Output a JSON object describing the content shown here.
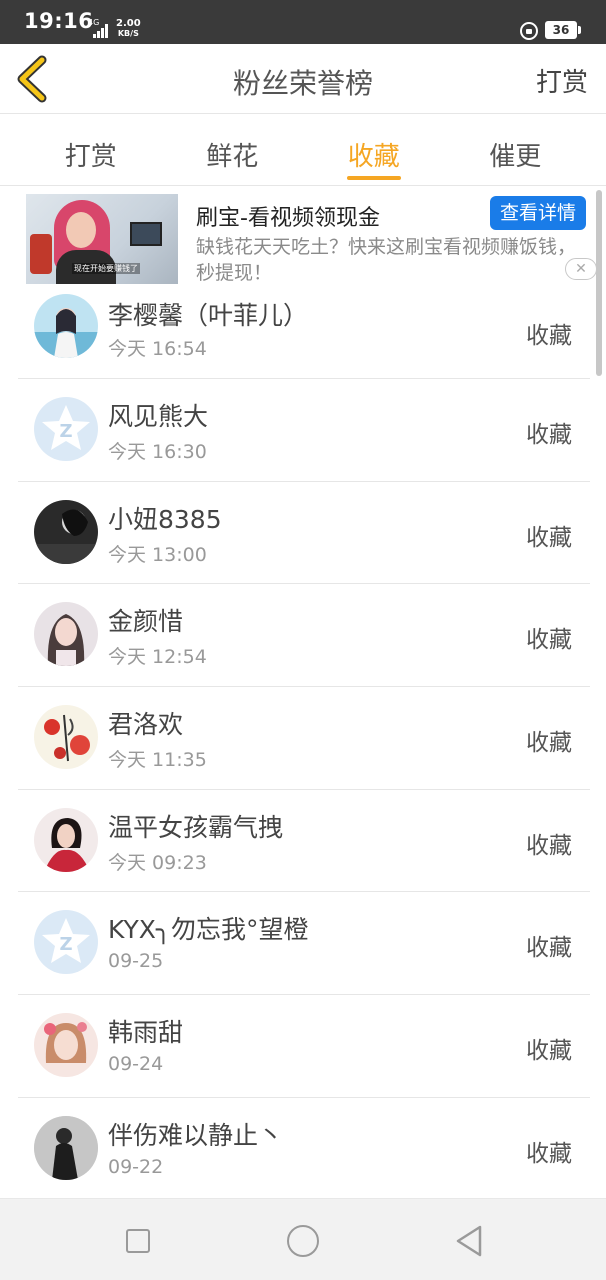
{
  "status_bar": {
    "time": "19:16",
    "network": "4G",
    "speed_value": "2.00",
    "speed_unit": "KB/S",
    "battery": "36"
  },
  "header": {
    "title": "粉丝荣誉榜",
    "right_action": "打赏",
    "back_icon": "chevron-left-icon",
    "accent_color": "#f5a623"
  },
  "tabs": [
    {
      "label": "打赏",
      "active": false
    },
    {
      "label": "鲜花",
      "active": false
    },
    {
      "label": "收藏",
      "active": true
    },
    {
      "label": "催更",
      "active": false
    }
  ],
  "ad": {
    "title": "刷宝-看视频领现金",
    "button": "查看详情",
    "description": "缺钱花天天吃土？快来这刷宝看视频赚饭钱，秒提现！",
    "thumb_caption": "现在开始要赚钱了",
    "close_icon": "close-icon"
  },
  "list": [
    {
      "name": "李樱馨（叶菲儿）",
      "time": "今天 16:54",
      "action": "收藏",
      "avatar": "photo"
    },
    {
      "name": "风见熊大",
      "time": "今天 16:30",
      "action": "收藏",
      "avatar": "default"
    },
    {
      "name": "小妞8385",
      "time": "今天 13:00",
      "action": "收藏",
      "avatar": "photo"
    },
    {
      "name": "金颜惜",
      "time": "今天 12:54",
      "action": "收藏",
      "avatar": "photo"
    },
    {
      "name": "君洛欢",
      "time": "今天 11:35",
      "action": "收藏",
      "avatar": "photo"
    },
    {
      "name": "温平女孩霸气拽",
      "time": "今天 09:23",
      "action": "收藏",
      "avatar": "photo"
    },
    {
      "name": "KYX╮勿忘我°望橙",
      "time": "09-25",
      "action": "收藏",
      "avatar": "default"
    },
    {
      "name": "韩雨甜",
      "time": "09-24",
      "action": "收藏",
      "avatar": "photo"
    },
    {
      "name": "伴伤难以静止丶",
      "time": "09-22",
      "action": "收藏",
      "avatar": "photo"
    }
  ],
  "nav": {
    "recent_icon": "square-icon",
    "home_icon": "circle-icon",
    "back_icon": "triangle-back-icon"
  }
}
